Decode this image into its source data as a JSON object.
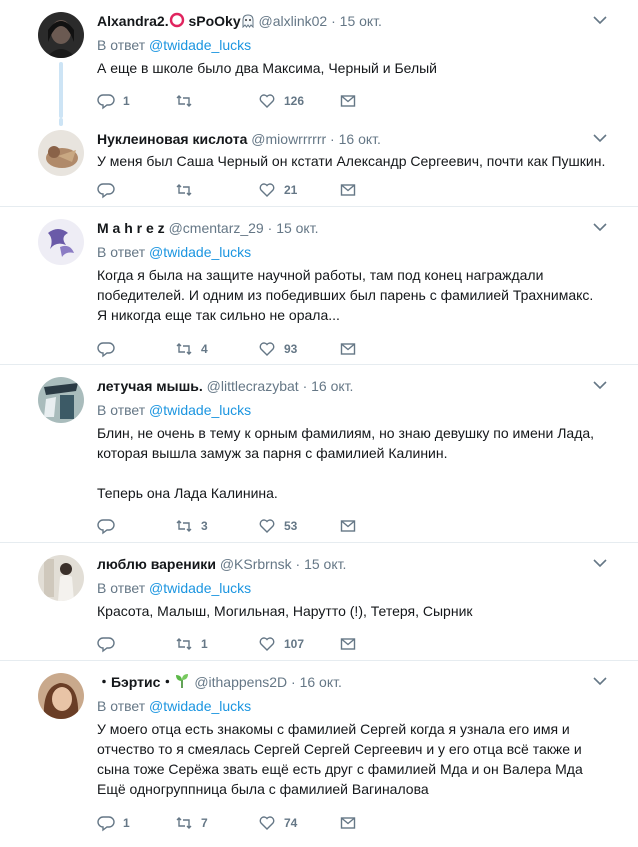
{
  "reply_prefix": "В ответ",
  "tweets": [
    {
      "name": "Alxandra2.",
      "name_suffix": " sPoOky",
      "handle": "@alxlink02",
      "time": "15 окт.",
      "reply_to": "@twidade_lucks",
      "text": "А еще в школе было два Максима, Черный и Белый",
      "replies": "1",
      "retweets": "",
      "likes": "126",
      "avatar_color": "#2b2b2b"
    },
    {
      "name": "Нуклеиновая кислота",
      "handle": "@miowrrrrrr",
      "time": "16 окт.",
      "reply_to": "",
      "text": "У меня был Саша Черный он кстати Александр Сергеевич, почти как Пушкин.",
      "replies": "",
      "retweets": "",
      "likes": "21",
      "avatar_color": "#b7b0a8"
    },
    {
      "name": "M a h r e z",
      "handle": "@cmentarz_29",
      "time": "15 окт.",
      "reply_to": "@twidade_lucks",
      "text": "Когда я была на защите научной работы, там под конец награждали\nпобедителей. И одним из победивших был парень с фамилией Трахнимакс.\nЯ никогда еще так сильно не орала...",
      "replies": "",
      "retweets": "4",
      "likes": "93",
      "avatar_color": "#e8e6f2"
    },
    {
      "name": "летучая мышь.",
      "handle": "@littlecrazybat",
      "time": "16 окт.",
      "reply_to": "@twidade_lucks",
      "text": "Блин, не очень в тему к орным фамилиям, но знаю девушку по имени Лада,\nкоторая вышла замуж за парня с фамилией Калинин.\n\nТеперь она Лада Калинина.",
      "replies": "",
      "retweets": "3",
      "likes": "53",
      "avatar_color": "#6f8a8a"
    },
    {
      "name": "люблю вареники",
      "handle": "@KSrbrnsk",
      "time": "15 окт.",
      "reply_to": "@twidade_lucks",
      "text": "Красота, Малыш, Могильная, Нарутто (!), Тетеря, Сырник",
      "replies": "",
      "retweets": "1",
      "likes": "107",
      "avatar_color": "#d9d4cc"
    },
    {
      "name": "・Бэртис・",
      "handle": "@ithappens2D",
      "time": "16 окт.",
      "reply_to": "@twidade_lucks",
      "text": "У моего отца есть знакомы с фамилией  Сергей когда я узнала  его имя и\nотчество то я смеялась Сергей Сергей Сергеевич и у его отца всё также и\nсына тоже Серёжа звать   ещё есть друг с фамилией Мда  и он Валера Мда\nЕщё  одногруппница  была с фамилией Вагиналова",
      "replies": "1",
      "retweets": "7",
      "likes": "74",
      "avatar_color": "#8a5a3c"
    }
  ]
}
